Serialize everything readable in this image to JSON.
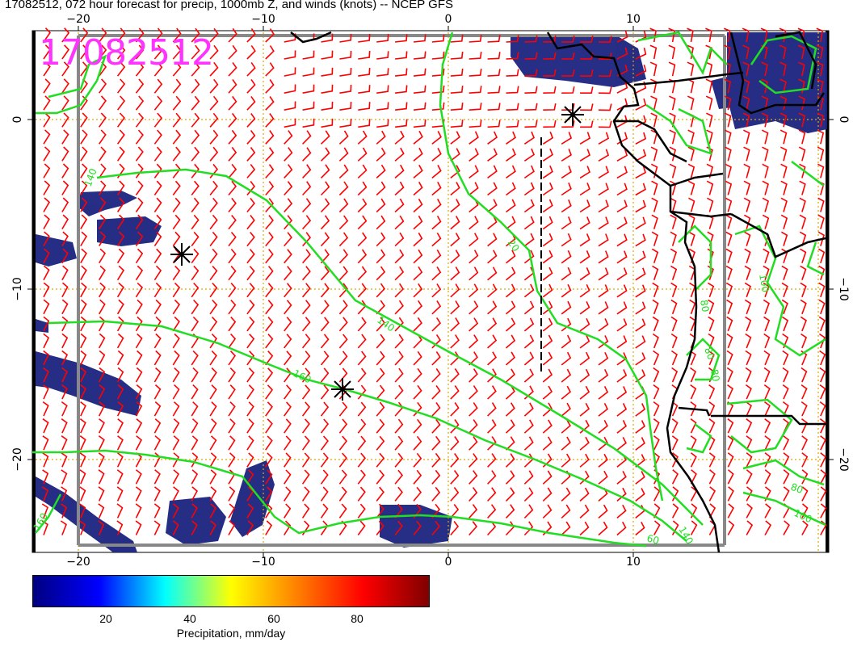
{
  "title": "17082512, 072 hour forecast for precip, 1000mb Z, and winds (knots) -- NCEP GFS",
  "overlay_date": "17082512",
  "axes": {
    "lon_ticks_top": [
      "−20",
      "−10",
      "0",
      "10"
    ],
    "lon_ticks_bottom": [
      "−20",
      "−10",
      "0",
      "10"
    ],
    "lat_ticks_left": [
      "0",
      "−10",
      "−20"
    ],
    "lat_ticks_right": [
      "0",
      "−10",
      "−20"
    ],
    "lon_range": [
      -23,
      21
    ],
    "lat_range": [
      -25,
      5
    ]
  },
  "contour_labels": [
    "140",
    "20",
    "140",
    "160",
    "80",
    "100",
    "80",
    "80",
    "60",
    "100",
    "80",
    "140",
    "160"
  ],
  "colorbar": {
    "ticks": [
      "20",
      "40",
      "60",
      "80"
    ],
    "label": "Precipitation, mm/day",
    "colors": [
      "#000080",
      "#0000ff",
      "#00ffff",
      "#ffff00",
      "#ff8000",
      "#ff0000",
      "#800000"
    ]
  },
  "colors": {
    "wind_barb": "#ff0000",
    "contour": "#22dd22",
    "grid": "#ddaa00",
    "frame": "#888888",
    "precip": "#1a237e"
  },
  "markers": [
    "high-pressure-marker",
    "high-pressure-marker",
    "high-pressure-marker"
  ]
}
